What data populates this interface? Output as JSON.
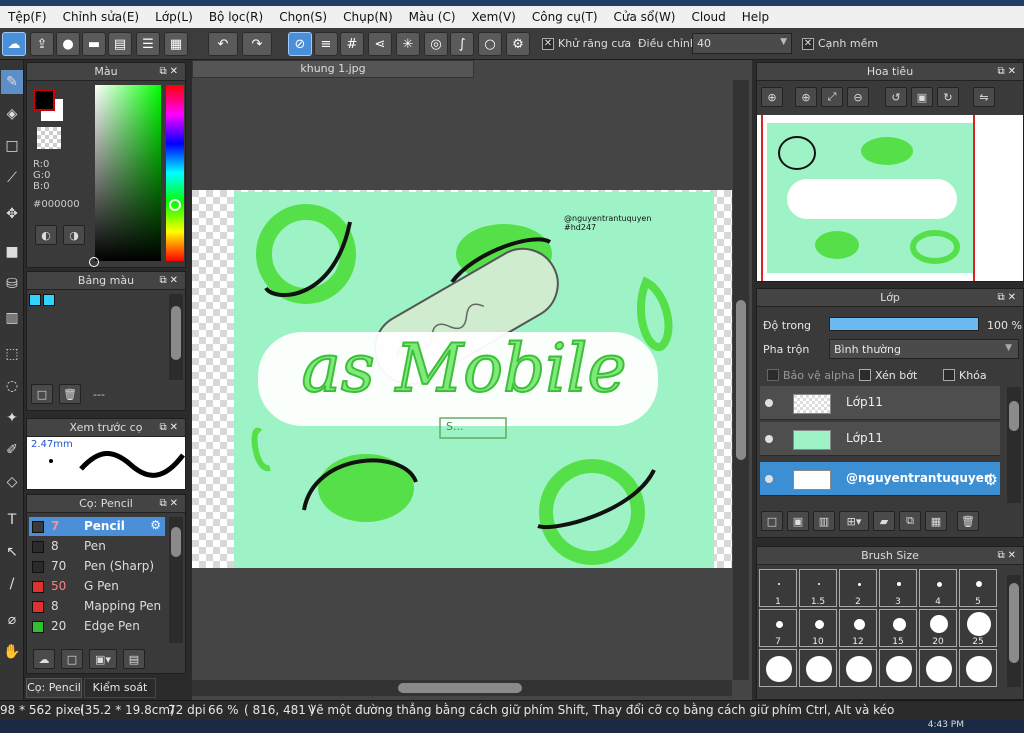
{
  "menu": [
    "Tệp(F)",
    "Chỉnh sửa(E)",
    "Lớp(L)",
    "Bộ lọc(R)",
    "Chọn(S)",
    "Chụp(N)",
    "Màu (C)",
    "Xem(V)",
    "Công cụ(T)",
    "Cửa sổ(W)",
    "Cloud",
    "Help"
  ],
  "toolbar": {
    "antialias_label": "Khử răng cưa",
    "adjust_label": "Điều chỉnh",
    "adjust_value": "40",
    "smooth_label": "Cạnh mềm"
  },
  "color_panel": {
    "title": "Màu",
    "r": "R:0",
    "g": "G:0",
    "b": "B:0",
    "hex": "#000000",
    "fg_color": "#000000",
    "bg_color": "#ffffff"
  },
  "palette_panel": {
    "title": "Bảng màu",
    "swatch_color": "#2fd5ff",
    "dash": "---"
  },
  "preview_panel": {
    "title": "Xem trước cọ",
    "size": "2.47mm"
  },
  "brush_panel": {
    "title": "Cọ: Pencil",
    "items": [
      {
        "size": "7",
        "name": "Pencil",
        "color": "#3a3a3a",
        "selected": true
      },
      {
        "size": "8",
        "name": "Pen",
        "color": "#2b2b2b"
      },
      {
        "size": "70",
        "name": "Pen (Sharp)",
        "color": "#2b2b2b"
      },
      {
        "size": "50",
        "name": "G Pen",
        "color": "#e03030"
      },
      {
        "size": "8",
        "name": "Mapping Pen",
        "color": "#e03030"
      },
      {
        "size": "20",
        "name": "Edge Pen",
        "color": "#30c030"
      }
    ]
  },
  "bottom_tabs": [
    "Cọ: Pencil",
    "Kiểm soát cọ"
  ],
  "document": {
    "tab": "khung 1.jpg",
    "credit_line1": "@nguyentrantuquyen",
    "credit_line2": "#hd247",
    "artwork_text": "as Mobile",
    "sub_text": "S..."
  },
  "navigator": {
    "title": "Hoa tiêu"
  },
  "layers_panel": {
    "title": "Lớp",
    "opacity_label": "Độ trong",
    "opacity_value": "100 %",
    "opacity": 1.0,
    "blend_label": "Pha trộn",
    "blend_value": "Bình thường",
    "protect_alpha": "Bảo vệ alpha",
    "clip": "Xén bớt",
    "lock": "Khóa",
    "layers": [
      {
        "name": "Lớp11",
        "selected": false
      },
      {
        "name": "Lớp11",
        "selected": false
      },
      {
        "name": "@nguyentrantuquyen",
        "selected": true
      }
    ]
  },
  "brush_size_panel": {
    "title": "Brush Size",
    "sizes": [
      "1",
      "1.5",
      "2",
      "3",
      "4",
      "5",
      "7",
      "10",
      "12",
      "15",
      "20",
      "25",
      "",
      "",
      "",
      "",
      "",
      ""
    ]
  },
  "status": {
    "dims": "98 * 562 pixel",
    "cm": "(35.2 * 19.8cm)",
    "dpi": "72 dpi",
    "zoom": "66 %",
    "coords": "( 816, 481 )",
    "hint": "Vẽ một đường thẳng bằng cách giữ phím Shift, Thay đổi cỡ cọ bằng cách giữ phím Ctrl, Alt và kéo"
  },
  "taskbar": {
    "time": "4:43 PM"
  }
}
